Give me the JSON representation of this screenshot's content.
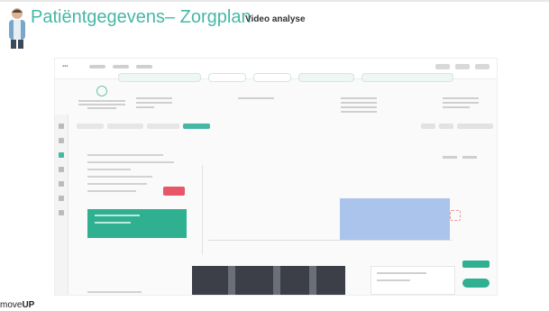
{
  "header": {
    "title": "Patiëntgegevens– Zorgplan",
    "subtitle": "Video analyse"
  },
  "footer": {
    "logo_prefix": "move",
    "logo_suffix": "UP"
  },
  "colors": {
    "title": "#45b8a5",
    "accent_green": "#2fb090",
    "badge_red": "#e8566a",
    "chart_bar": "#aac4ec"
  }
}
